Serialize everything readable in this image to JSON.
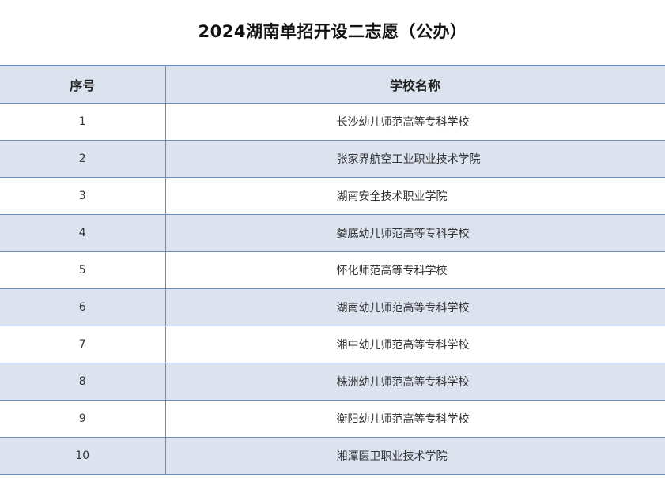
{
  "title": "2024湖南单招开设二志愿（公办）",
  "table": {
    "headers": [
      "序号",
      "学校名称"
    ],
    "rows": [
      {
        "no": "1",
        "name": "长沙幼儿师范高等专科学校"
      },
      {
        "no": "2",
        "name": "张家界航空工业职业技术学院"
      },
      {
        "no": "3",
        "name": "湖南安全技术职业学院"
      },
      {
        "no": "4",
        "name": "娄底幼儿师范高等专科学校"
      },
      {
        "no": "5",
        "name": "怀化师范高等专科学校"
      },
      {
        "no": "6",
        "name": "湖南幼儿师范高等专科学校"
      },
      {
        "no": "7",
        "name": "湘中幼儿师范高等专科学校"
      },
      {
        "no": "8",
        "name": "株洲幼儿师范高等专科学校"
      },
      {
        "no": "9",
        "name": "衡阳幼儿师范高等专科学校"
      },
      {
        "no": "10",
        "name": "湘潭医卫职业技术学院"
      }
    ]
  },
  "colors": {
    "header_bg": "#dce3ef",
    "stripe_bg": "#dce3ef",
    "border": "#6b8cc0"
  }
}
